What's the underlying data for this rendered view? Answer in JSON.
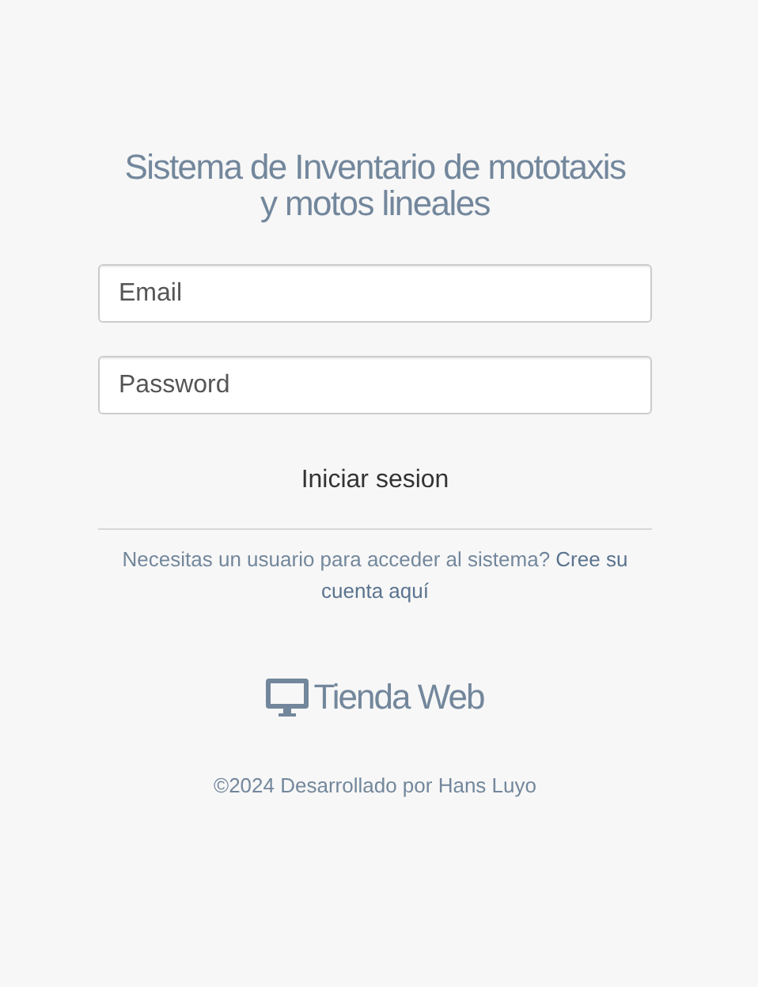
{
  "title": "Sistema de Inventario de mototaxis y motos lineales",
  "fields": [
    {
      "placeholder": "Email"
    },
    {
      "placeholder": "Password"
    }
  ],
  "submit": "Iniciar sesion",
  "signup": {
    "text": "Necesitas un usuario para acceder al sistema?",
    "link_lines": [
      "Cree su",
      "cuenta aquí"
    ]
  },
  "brand": "Tienda Web",
  "footer": "©2024 Desarrollado por Hans Luyo"
}
